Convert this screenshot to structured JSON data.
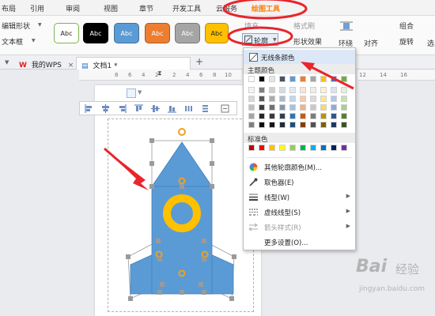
{
  "menubar": {
    "items": [
      "布局",
      "引用",
      "审阅",
      "视图",
      "章节",
      "开发工具",
      "云服务",
      "绘图工具"
    ],
    "active": "绘图工具"
  },
  "ribbon": {
    "edit_shape": "编辑形状",
    "text_box": "文本框",
    "style_swatches": [
      "Abc",
      "Abc",
      "Abc",
      "Abc",
      "Abc",
      "Abc"
    ],
    "swatch_colors": [
      "#ffffff",
      "#000000",
      "#5b9bd5",
      "#ed7d31",
      "#a5a5a5",
      "#ffc000"
    ],
    "fill_label": "填充",
    "format_label": "格式刷",
    "outline_label": "轮廓",
    "effect_label": "形状效果",
    "wrap_label": "环绕",
    "align_label": "对齐",
    "group_label": "组合",
    "rotate_label": "旋转",
    "select_label": "选"
  },
  "tabs": {
    "home_tab": "我的WPS",
    "doc_tab": "文档1 *",
    "close_glyph": "×",
    "new_tab_glyph": "+"
  },
  "ruler": {
    "numbers": [
      "8",
      "6",
      "4",
      "2",
      "",
      "2",
      "4",
      "6",
      "8",
      "10",
      "12",
      "14",
      "16"
    ]
  },
  "outline_menu": {
    "no_line": "无线条颜色",
    "theme_colors_title": "主题颜色",
    "theme_top_row": [
      "#ffffff",
      "#000000",
      "#e7e6e6",
      "#44546a",
      "#5b9bd5",
      "#ed7d31",
      "#a5a5a5",
      "#ffc000",
      "#4472c4",
      "#70ad47"
    ],
    "theme_shades": [
      [
        "#f2f2f2",
        "#7f7f7f",
        "#d0cece",
        "#d6dce4",
        "#deebf6",
        "#fbe5d5",
        "#ededed",
        "#fff2cc",
        "#dae3f3",
        "#e2efd9"
      ],
      [
        "#d8d8d8",
        "#595959",
        "#aeabab",
        "#adb9ca",
        "#bdd7ee",
        "#f7cbac",
        "#dbdbdb",
        "#fee599",
        "#b4c6e7",
        "#c5e0b3"
      ],
      [
        "#bfbfbf",
        "#3f3f3f",
        "#757070",
        "#8496b0",
        "#9dc3e6",
        "#f4b183",
        "#c9c9c9",
        "#ffd965",
        "#8eaadb",
        "#a8d08d"
      ],
      [
        "#a5a5a5",
        "#262626",
        "#3a3838",
        "#323f4f",
        "#2e75b5",
        "#c55a11",
        "#7b7b7b",
        "#bf9000",
        "#2f5496",
        "#538135"
      ],
      [
        "#7f7f7f",
        "#0c0c0c",
        "#171616",
        "#222a35",
        "#1e4e79",
        "#833c0b",
        "#525252",
        "#7f6000",
        "#1f3864",
        "#375623"
      ]
    ],
    "standard_colors_title": "标准色",
    "standard_colors": [
      "#c00000",
      "#ff0000",
      "#ffc000",
      "#ffff00",
      "#92d050",
      "#00b050",
      "#00b0f0",
      "#0070c0",
      "#002060",
      "#7030a0"
    ],
    "more_colors": "其他轮廓颜色(M)...",
    "eyedropper": "取色器(E)",
    "line_weight": "线型(W)",
    "dash_type": "虚线线型(S)",
    "arrow_style": "箭头样式(R)",
    "more_settings": "更多设置(O)..."
  },
  "shape": {
    "body_color": "#5b9bd5",
    "ring_color": "#ffc000"
  },
  "watermark": {
    "text1": "Bai",
    "text2": "经验",
    "text3": "jingyan.baidu.com"
  },
  "annotation_color": "#e8262c"
}
